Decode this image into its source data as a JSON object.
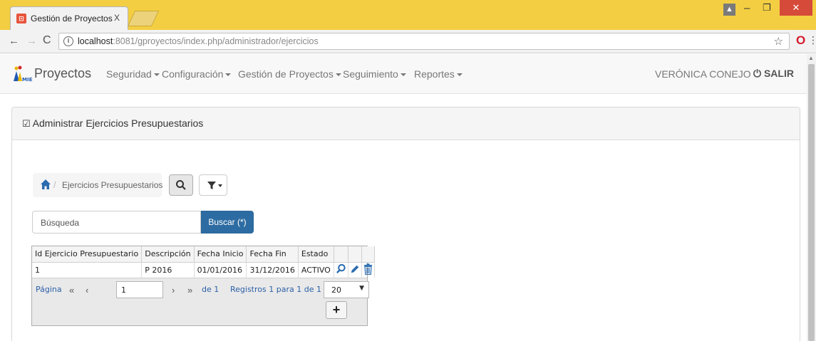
{
  "browser": {
    "tab_title": "Gestión de Proyectos",
    "tab_close": "X",
    "url_host": "localhost",
    "url_rest": ":8081/gproyectos/index.php/administrador/ejercicios"
  },
  "navbar": {
    "brand": "Proyectos",
    "logo_text": "MIES",
    "menus": [
      {
        "label": "Seguridad"
      },
      {
        "label": "Configuración"
      },
      {
        "label": "Gestión de Proyectos"
      },
      {
        "label": "Seguimiento"
      },
      {
        "label": "Reportes"
      }
    ],
    "user": "VERÓNICA CONEJO",
    "logout": "SALIR"
  },
  "panel": {
    "title": "Administrar Ejercicios Presupuestarios"
  },
  "breadcrumb": {
    "separator": "/",
    "current": "Ejercicios Presupuestarios"
  },
  "search": {
    "placeholder": "Búsqueda",
    "button_label": "Buscar (*)"
  },
  "grid": {
    "columns": [
      "Id Ejercicio Presupuestario",
      "Descripción",
      "Fecha Inicio",
      "Fecha Fin",
      "Estado"
    ],
    "rows": [
      {
        "id": "1",
        "descripcion": "P 2016",
        "fecha_inicio": "01/01/2016",
        "fecha_fin": "31/12/2016",
        "estado": "ACTIVO"
      }
    ]
  },
  "pager": {
    "page_label": "Página",
    "page_value": "1",
    "of_label": "de 1",
    "records_label": "Registros 1 para 1 de 1",
    "page_size": "20",
    "first": "«",
    "prev": "‹",
    "next": "›",
    "last": "»"
  },
  "colors": {
    "accent": "#2d6ca2",
    "chrome_frame": "#f3ce42",
    "link": "#2b5fa8",
    "row_icon": "#2b6cb0"
  }
}
